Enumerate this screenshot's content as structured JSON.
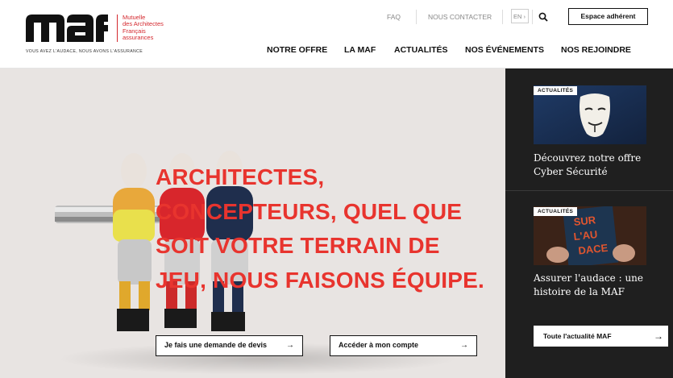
{
  "logo": {
    "wordmark": "maf",
    "lines": [
      "Mutuelle",
      "des Architectes",
      "Français",
      "assurances"
    ],
    "tagline": "VOUS AVEZ L'AUDACE, NOUS AVONS L'ASSURANCE"
  },
  "utility": {
    "faq": "FAQ",
    "contact": "NOUS CONTACTER",
    "lang": "EN ›",
    "member_button": "Espace adhérent"
  },
  "nav": [
    "NOTRE OFFRE",
    "LA MAF",
    "ACTUALITÉS",
    "NOS ÉVÉNEMENTS",
    "NOS REJOINDRE"
  ],
  "hero": {
    "title": "ARCHITECTES, CONCEPTEURS, QUEL QUE SOIT VOTRE TERRAIN DE JEU, NOUS FAISONS ÉQUIPE.",
    "cta_primary": "Je fais une demande de devis",
    "cta_secondary": "Accéder à mon compte",
    "arrow": "→"
  },
  "news": {
    "cards": [
      {
        "badge": "ACTUALITÉS",
        "title": "Découvrez notre offre Cyber Sécurité"
      },
      {
        "badge": "ACTUALITÉS",
        "title": "Assurer l'audace : une histoire de la MAF"
      }
    ],
    "all_label": "Toute l'actualité MAF",
    "arrow": "→"
  },
  "colors": {
    "accent": "#e8342e",
    "brand_red": "#d4282e",
    "dark_panel": "#1f1f1f",
    "hero_bg": "#e8e4e2"
  }
}
